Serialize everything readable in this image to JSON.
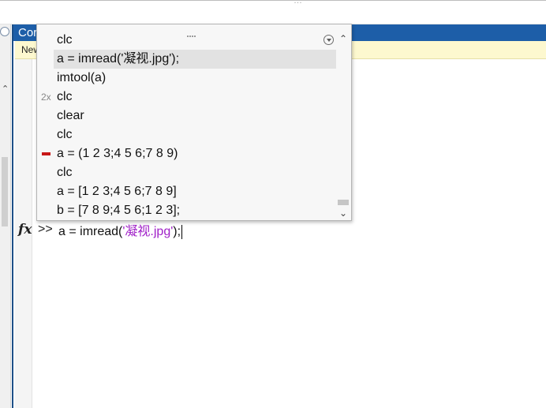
{
  "titlebar": {
    "text": "…"
  },
  "command_window": {
    "title": "Cor",
    "new_notice": "New",
    "prompt_symbol": ">>",
    "command_prefix": "a = imread(",
    "command_string": "'凝视.jpg'",
    "command_suffix": ");"
  },
  "history": {
    "items": [
      {
        "text": "clc",
        "badge": "",
        "error": false,
        "selected": false
      },
      {
        "text": "a = imread('凝视.jpg');",
        "badge": "",
        "error": false,
        "selected": true
      },
      {
        "text": "imtool(a)",
        "badge": "",
        "error": false,
        "selected": false
      },
      {
        "text": "clc",
        "badge": "2x",
        "error": false,
        "selected": false
      },
      {
        "text": "clear",
        "badge": "",
        "error": false,
        "selected": false
      },
      {
        "text": "clc",
        "badge": "",
        "error": false,
        "selected": false
      },
      {
        "text": "a = (1 2 3;4 5 6;7 8 9)",
        "badge": "",
        "error": true,
        "selected": false
      },
      {
        "text": "clc",
        "badge": "",
        "error": false,
        "selected": false
      },
      {
        "text": "a = [1 2 3;4 5 6;7 8 9]",
        "badge": "",
        "error": false,
        "selected": false
      },
      {
        "text": "b = [7 8 9;4 5 6;1 2 3];",
        "badge": "",
        "error": false,
        "selected": false
      }
    ]
  },
  "colors": {
    "header": "#1d5ea8",
    "string": "#a020c8",
    "error_mark": "#c81818",
    "notice_bg": "#fdf8cf"
  }
}
